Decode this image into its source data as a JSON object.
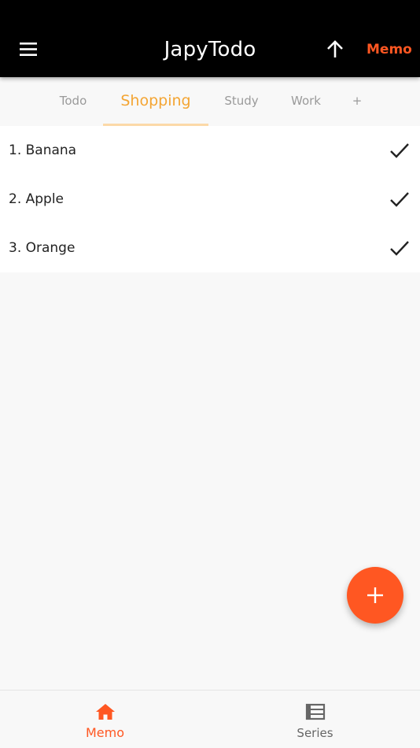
{
  "header": {
    "title": "JapyTodo",
    "menu_icon": "hamburger-menu-icon",
    "up_icon": "arrow-up-icon",
    "memo_link": "Memo",
    "accent_color": "#ff5722"
  },
  "tabs": [
    {
      "label": "Todo",
      "active": false
    },
    {
      "label": "Shopping",
      "active": true
    },
    {
      "label": "Study",
      "active": false
    },
    {
      "label": "Work",
      "active": false
    },
    {
      "label": "+",
      "active": false
    }
  ],
  "tab_active_color": "#f4a533",
  "items": [
    {
      "text": "1. Banana",
      "icon": "checkmark-icon"
    },
    {
      "text": "2. Apple",
      "icon": "checkmark-icon"
    },
    {
      "text": "3. Orange",
      "icon": "checkmark-icon"
    }
  ],
  "fab": {
    "icon": "plus-icon"
  },
  "bottom_nav": [
    {
      "label": "Memo",
      "icon": "home-icon",
      "active": true
    },
    {
      "label": "Series",
      "icon": "list-icon",
      "active": false
    }
  ]
}
